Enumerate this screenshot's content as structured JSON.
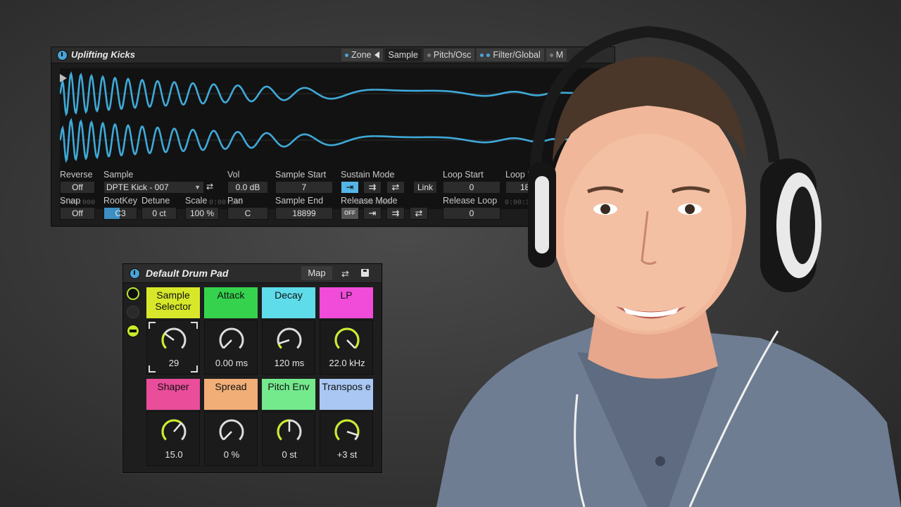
{
  "sampler": {
    "title": "Uplifting Kicks",
    "tabs": [
      "Zone",
      "Sample",
      "Pitch/Osc",
      "Filter/Global",
      "M"
    ],
    "time_labels": [
      "0:00:000",
      "0:00:100",
      "0:00:200",
      "0:00:3"
    ],
    "reverse": {
      "label": "Reverse",
      "value": "Off"
    },
    "snap": {
      "label": "Snap",
      "value": "Off"
    },
    "sample": {
      "label": "Sample",
      "value": "DPTE Kick - 007"
    },
    "rootkey": {
      "label": "RootKey",
      "value": "C3"
    },
    "detune": {
      "label": "Detune",
      "value": "0 ct"
    },
    "scale": {
      "label": "Scale",
      "value": "100 %"
    },
    "vol": {
      "label": "Vol",
      "value": "0.0 dB"
    },
    "pan": {
      "label": "Pan",
      "value": "C"
    },
    "sample_start": {
      "label": "Sample Start",
      "value": "7"
    },
    "sample_end": {
      "label": "Sample End",
      "value": "18899"
    },
    "sustain_mode": {
      "label": "Sustain Mode",
      "link": "Link"
    },
    "release_mode": {
      "label": "Release Mode",
      "off": "OFF"
    },
    "loop_start": {
      "label": "Loop Start",
      "value": "0"
    },
    "loop_end": {
      "label": "Loop End",
      "value": "188"
    },
    "release_loop": {
      "label": "Release Loop",
      "value": "0"
    },
    "accent": "#4aa3d6",
    "wave_color": "#3fa9d8"
  },
  "rack": {
    "title": "Default Drum Pad",
    "map": "Map",
    "macros": [
      {
        "label": "Sample Selector",
        "value": "29",
        "color": "#d7e82a",
        "level": 0.3
      },
      {
        "label": "Attack",
        "value": "0.00 ms",
        "color": "#35d34d",
        "level": 0.0
      },
      {
        "label": "Decay",
        "value": "120 ms",
        "color": "#5fdcea",
        "level": 0.1
      },
      {
        "label": "LP",
        "value": "22.0 kHz",
        "color": "#f04bd9",
        "level": 1.0
      },
      {
        "label": "Shaper",
        "value": "15.0",
        "color": "#ea4d9a",
        "level": 0.65
      },
      {
        "label": "Spread",
        "value": "0 %",
        "color": "#f1ae77",
        "level": 0.0
      },
      {
        "label": "Pitch Env",
        "value": "0 st",
        "color": "#74ea8d",
        "level": 0.5
      },
      {
        "label": "Transpos e",
        "value": "+3 st",
        "color": "#a9c7f2",
        "level": 0.9
      }
    ],
    "knob_track": "#dcdcdc",
    "knob_active": "#c9ee2d"
  }
}
